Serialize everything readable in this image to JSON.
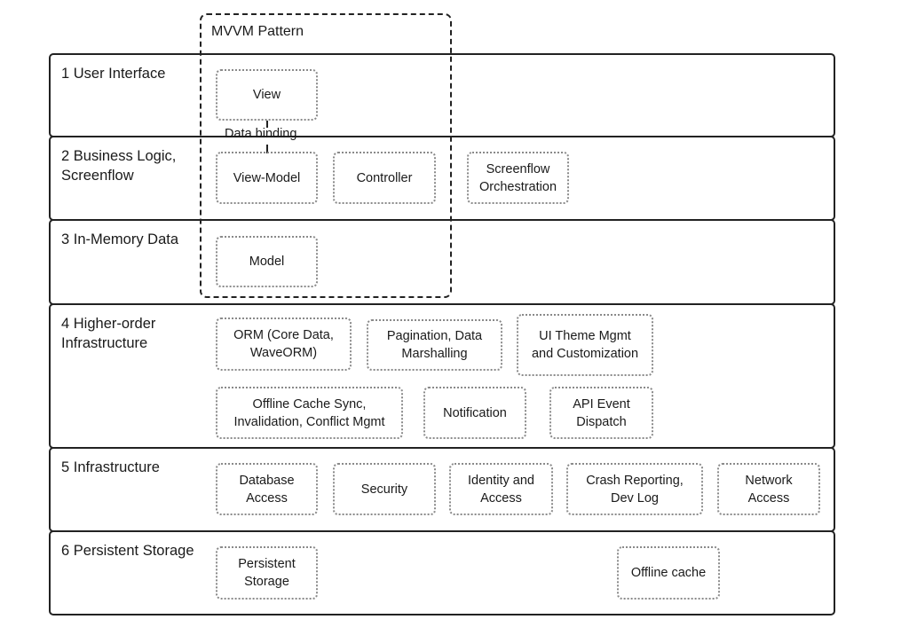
{
  "diagram": {
    "mvvm_group": {
      "title": "MVVM Pattern"
    },
    "data_binding_label": "Data binding",
    "layers": [
      {
        "label": "1 User Interface",
        "components": [
          "View"
        ]
      },
      {
        "label": "2 Business Logic,\n   Screenflow",
        "components": [
          "View-Model",
          "Controller",
          "Screenflow\nOrchestration"
        ]
      },
      {
        "label": "3 In-Memory Data",
        "components": [
          "Model"
        ]
      },
      {
        "label": "4 Higher-order\n   Infrastructure",
        "components": [
          "ORM (Core Data,\nWaveORM)",
          "Pagination, Data\nMarshalling",
          "UI Theme Mgmt\nand Customization",
          "Offline Cache Sync,\nInvalidation, Conflict Mgmt",
          "Notification",
          "API Event\nDispatch"
        ]
      },
      {
        "label": "5 Infrastructure",
        "components": [
          "Database\nAccess",
          "Security",
          "Identity and\nAccess",
          "Crash Reporting,\nDev Log",
          "Network\nAccess"
        ]
      },
      {
        "label": "6 Persistent Storage",
        "components": [
          "Persistent\nStorage",
          "Offline cache"
        ]
      }
    ]
  }
}
